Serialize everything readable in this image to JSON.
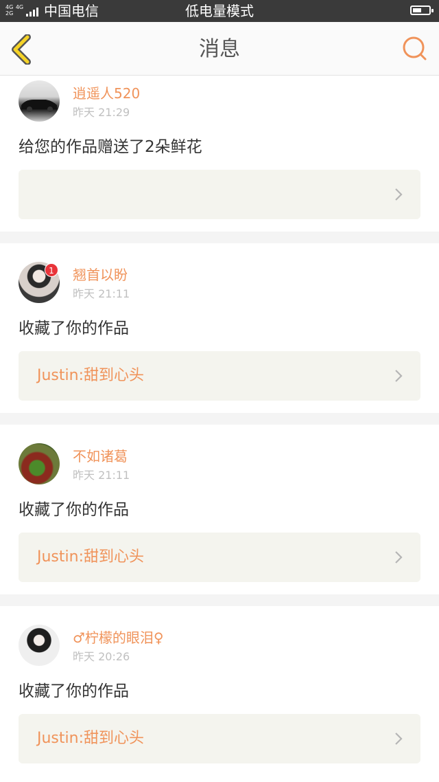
{
  "status_bar": {
    "network_label": "4G 4G 2G",
    "carrier": "中国电信",
    "mode": "低电量模式"
  },
  "header": {
    "title": "消息",
    "back_icon": "chevron-left-icon",
    "search_icon": "search-icon"
  },
  "colors": {
    "accent": "#f0935a",
    "back_icon_fill": "#f5d327",
    "link_bg": "#f4f4ee",
    "badge": "#e8343a"
  },
  "messages": [
    {
      "user": "逍遥人520",
      "time": "昨天 21:29",
      "action": "给您的作品赠送了2朵鲜花",
      "work_title": "",
      "avatar": "car-avatar"
    },
    {
      "user": "翘首以盼",
      "time": "昨天 21:11",
      "action": "收藏了你的作品",
      "work_title": "Justin:甜到心头",
      "avatar": "person-avatar",
      "badge": "1"
    },
    {
      "user": "不如诸葛",
      "time": "昨天 21:11",
      "action": "收藏了你的作品",
      "work_title": "Justin:甜到心头",
      "avatar": "flower-avatar"
    },
    {
      "user": "♂柠檬的眼泪♀",
      "time": "昨天 20:26",
      "action": "收藏了你的作品",
      "work_title": "Justin:甜到心头",
      "avatar": "girl-avatar"
    }
  ]
}
